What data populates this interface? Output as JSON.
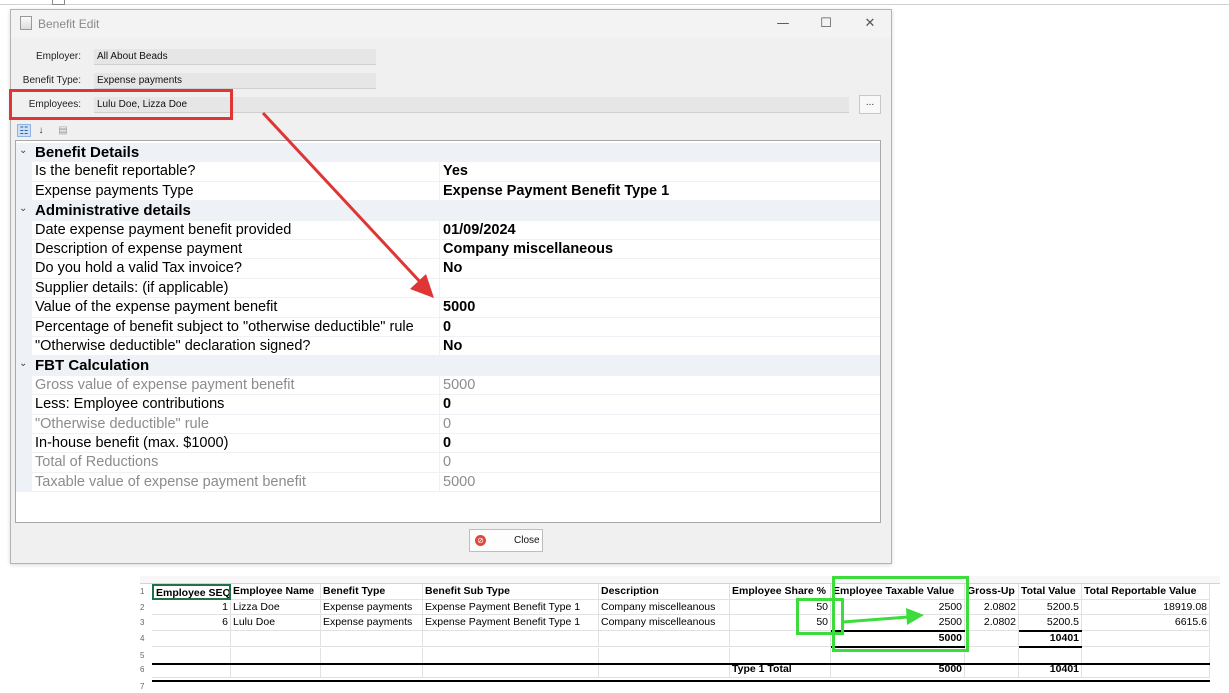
{
  "window": {
    "title": "Benefit Edit",
    "controls": {
      "minimize": "—",
      "maximize": "☐",
      "close": "✕"
    }
  },
  "form": {
    "employer_label": "Employer:",
    "employer_value": "All About Beads",
    "benefit_type_label": "Benefit Type:",
    "benefit_type_value": "Expense payments",
    "employees_label": "Employees:",
    "employees_value": "Lulu Doe, Lizza Doe",
    "more_button": "..."
  },
  "toolbar": {
    "categorized_icon": "categorized-icon",
    "alphabetical_icon": "alphabetical-sort-icon",
    "property_pages_icon": "property-pages-icon"
  },
  "grid": {
    "categories": [
      {
        "label": "Benefit Details",
        "rows": [
          {
            "name": "Is the benefit reportable?",
            "value": "Yes",
            "readonly": false
          },
          {
            "name": "Expense payments Type",
            "value": "Expense Payment Benefit Type 1",
            "readonly": false
          }
        ]
      },
      {
        "label": "Administrative details",
        "rows": [
          {
            "name": "Date expense payment benefit provided",
            "value": "01/09/2024",
            "readonly": false
          },
          {
            "name": "Description of expense payment",
            "value": "Company miscellaneous",
            "readonly": false
          },
          {
            "name": "Do you hold a valid Tax invoice?",
            "value": "No",
            "readonly": false
          },
          {
            "name": "Supplier details: (if applicable)",
            "value": "",
            "readonly": false
          },
          {
            "name": "Value of the expense payment benefit",
            "value": "5000",
            "readonly": false
          },
          {
            "name": "Percentage of benefit subject to \"otherwise deductible\" rule",
            "value": "0",
            "readonly": false
          },
          {
            "name": "\"Otherwise deductible\" declaration signed?",
            "value": "No",
            "readonly": false
          }
        ]
      },
      {
        "label": "FBT Calculation",
        "rows": [
          {
            "name": "Gross value of expense payment benefit",
            "value": "5000",
            "readonly": true
          },
          {
            "name": "Less: Employee contributions",
            "value": "0",
            "readonly": false
          },
          {
            "name": "\"Otherwise deductible\" rule",
            "value": "0",
            "readonly": true
          },
          {
            "name": "In-house benefit (max. $1000)",
            "value": "0",
            "readonly": false
          },
          {
            "name": "Total of Reductions",
            "value": "0",
            "readonly": true
          },
          {
            "name": "Taxable value of expense payment benefit",
            "value": "5000",
            "readonly": true
          }
        ]
      }
    ]
  },
  "close_button": {
    "label": "Close",
    "icon": "cancel-icon"
  },
  "spreadsheet": {
    "row_numbers": [
      "1",
      "2",
      "3",
      "4",
      "5",
      "6",
      "7"
    ],
    "headers": [
      "Employee SEQ",
      "Employee Name",
      "Benefit Type",
      "Benefit Sub Type",
      "Description",
      "Employee Share %",
      "Employee Taxable Value",
      "Gross-Up",
      "Total Value",
      "Total Reportable Value"
    ],
    "rows": [
      [
        "1",
        "Lizza Doe",
        "Expense payments",
        "Expense Payment Benefit Type 1",
        "Company miscelleanous",
        "50",
        "2500",
        "2.0802",
        "5200.5",
        "18919.08"
      ],
      [
        "6",
        "Lulu Doe",
        "Expense payments",
        "Expense Payment Benefit Type 1",
        "Company miscelleanous",
        "50",
        "2500",
        "2.0802",
        "5200.5",
        "6615.6"
      ]
    ],
    "subtotal": {
      "taxable": "5000",
      "total": "10401"
    },
    "type_total": {
      "label": "Type 1 Total",
      "taxable": "5000",
      "total": "10401"
    }
  },
  "colors": {
    "red_annotation": "#e03535",
    "green_annotation": "#3ddc3d"
  }
}
